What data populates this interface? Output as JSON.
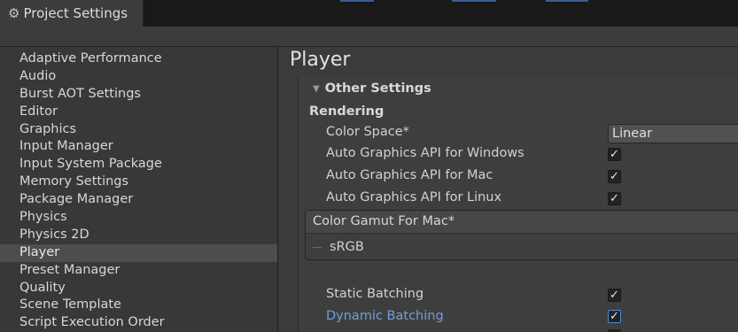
{
  "window": {
    "tab_title": "Project Settings",
    "tab_icon": "gear-icon"
  },
  "sidebar": {
    "items": [
      {
        "label": "Adaptive Performance"
      },
      {
        "label": "Audio"
      },
      {
        "label": "Burst AOT Settings"
      },
      {
        "label": "Editor"
      },
      {
        "label": "Graphics"
      },
      {
        "label": "Input Manager"
      },
      {
        "label": "Input System Package"
      },
      {
        "label": "Memory Settings"
      },
      {
        "label": "Package Manager"
      },
      {
        "label": "Physics"
      },
      {
        "label": "Physics 2D"
      },
      {
        "label": "Player",
        "selected": true
      },
      {
        "label": "Preset Manager"
      },
      {
        "label": "Quality"
      },
      {
        "label": "Scene Template"
      },
      {
        "label": "Script Execution Order"
      }
    ]
  },
  "main": {
    "title": "Player",
    "section": {
      "header": "Other Settings",
      "subheader": "Rendering",
      "color_space": {
        "label": "Color Space*",
        "value": "Linear"
      },
      "auto_api_windows": {
        "label": "Auto Graphics API  for Windows",
        "checked": true
      },
      "auto_api_mac": {
        "label": "Auto Graphics API  for Mac",
        "checked": true
      },
      "auto_api_linux": {
        "label": "Auto Graphics API  for Linux",
        "checked": true
      },
      "color_gamut": {
        "header": "Color Gamut For Mac*",
        "items": [
          "sRGB"
        ]
      },
      "static_batching": {
        "label": "Static Batching",
        "checked": true
      },
      "dynamic_batching": {
        "label": "Dynamic Batching",
        "checked": true
      },
      "checkmark": "✓"
    }
  }
}
